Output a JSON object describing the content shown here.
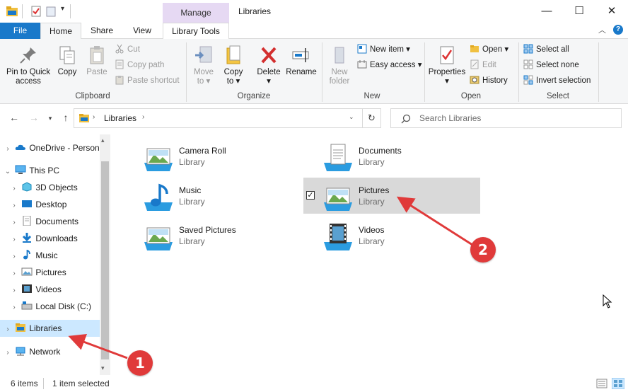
{
  "window": {
    "title": "Libraries",
    "context_tab": "Manage",
    "minimize": "—",
    "maximize": "☐",
    "close": "✕"
  },
  "tabs": {
    "file": "File",
    "home": "Home",
    "share": "Share",
    "view": "View",
    "library_tools": "Library Tools"
  },
  "ribbon": {
    "clipboard": {
      "label": "Clipboard",
      "pin_line1": "Pin to Quick",
      "pin_line2": "access",
      "copy": "Copy",
      "paste": "Paste",
      "cut": "Cut",
      "copy_path": "Copy path",
      "paste_shortcut": "Paste shortcut"
    },
    "organize": {
      "label": "Organize",
      "move_to_line1": "Move",
      "move_to_line2": "to",
      "copy_to_line1": "Copy",
      "copy_to_line2": "to",
      "delete": "Delete",
      "rename": "Rename"
    },
    "new": {
      "label": "New",
      "new_folder_line1": "New",
      "new_folder_line2": "folder",
      "new_item": "New item",
      "easy_access": "Easy access"
    },
    "open": {
      "label": "Open",
      "properties": "Properties",
      "open": "Open",
      "edit": "Edit",
      "history": "History"
    },
    "select": {
      "label": "Select",
      "select_all": "Select all",
      "select_none": "Select none",
      "invert_selection": "Invert selection"
    }
  },
  "address": {
    "crumb": "Libraries",
    "search_placeholder": "Search Libraries"
  },
  "nav": {
    "items": [
      {
        "label": "OneDrive - Personal"
      },
      {
        "label": "This PC"
      },
      {
        "label": "3D Objects"
      },
      {
        "label": "Desktop"
      },
      {
        "label": "Documents"
      },
      {
        "label": "Downloads"
      },
      {
        "label": "Music"
      },
      {
        "label": "Pictures"
      },
      {
        "label": "Videos"
      },
      {
        "label": "Local Disk (C:)"
      },
      {
        "label": "Libraries"
      },
      {
        "label": "Network"
      }
    ]
  },
  "libraries": [
    {
      "name": "Camera Roll",
      "type": "Library"
    },
    {
      "name": "Documents",
      "type": "Library"
    },
    {
      "name": "Music",
      "type": "Library"
    },
    {
      "name": "Pictures",
      "type": "Library"
    },
    {
      "name": "Saved Pictures",
      "type": "Library"
    },
    {
      "name": "Videos",
      "type": "Library"
    }
  ],
  "status": {
    "item_count": "6 items",
    "selected": "1 item selected"
  },
  "annotations": {
    "badge1": "1",
    "badge2": "2"
  },
  "colors": {
    "accent": "#1979ca",
    "selection": "#cce8ff",
    "manage_tab": "#e6d9f3",
    "annotation": "#e03a3a"
  }
}
